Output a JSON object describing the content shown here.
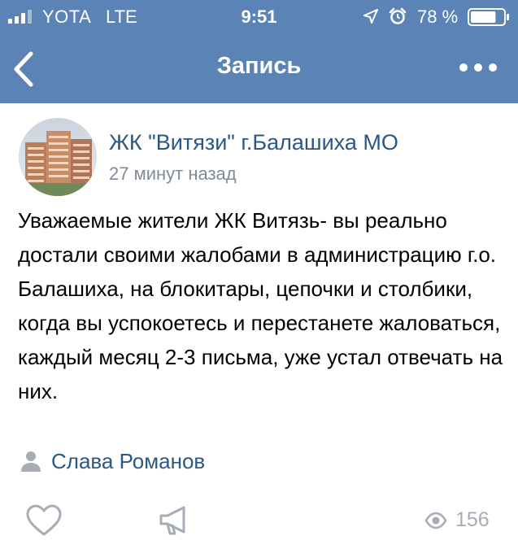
{
  "status_bar": {
    "carrier": "YOTA",
    "network": "LTE",
    "time": "9:51",
    "battery_percent": "78 %",
    "battery_level": 0.78,
    "icons": [
      "signal-icon",
      "location-icon",
      "alarm-icon",
      "battery-icon"
    ]
  },
  "nav": {
    "title": "Запись",
    "back_icon": "chevron-left-icon",
    "more_icon": "more-icon"
  },
  "post": {
    "author": "ЖК \"Витязи\" г.Балашиха МО",
    "time": "27 минут назад",
    "text": "Уважаемые жители ЖК Витязь- вы реально достали своими жалобами в администрацию г.о. Балашиха, на блокитары, цепочки и столбики, когда вы успокоетесь и перестанете жаловаться, каждый месяц 2-3 письма, уже устал отвечать на них.",
    "signer": "Слава Романов",
    "views": "156"
  },
  "colors": {
    "header": "#5b83b5",
    "link": "#2a5885",
    "secondary_text": "#828a99",
    "icon_gray": "#a7adb7"
  }
}
